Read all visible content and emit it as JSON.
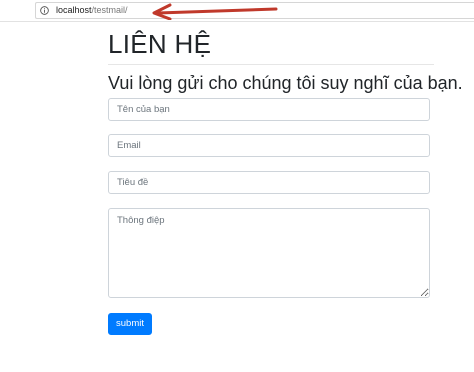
{
  "browser": {
    "url_host": "localhost",
    "url_path": "/testmail/",
    "info_icon": "info-circle-icon",
    "annotation_arrow_color": "#c0392b"
  },
  "page": {
    "title": "LIÊN HỆ",
    "subtitle": "Vui lòng gửi cho chúng tôi suy nghĩ của bạn."
  },
  "form": {
    "name_placeholder": "Tên của bạn",
    "email_placeholder": "Email",
    "subject_placeholder": "Tiêu đề",
    "message_placeholder": "Thông điệp",
    "submit_label": "submit",
    "submit_color": "#007bff"
  }
}
